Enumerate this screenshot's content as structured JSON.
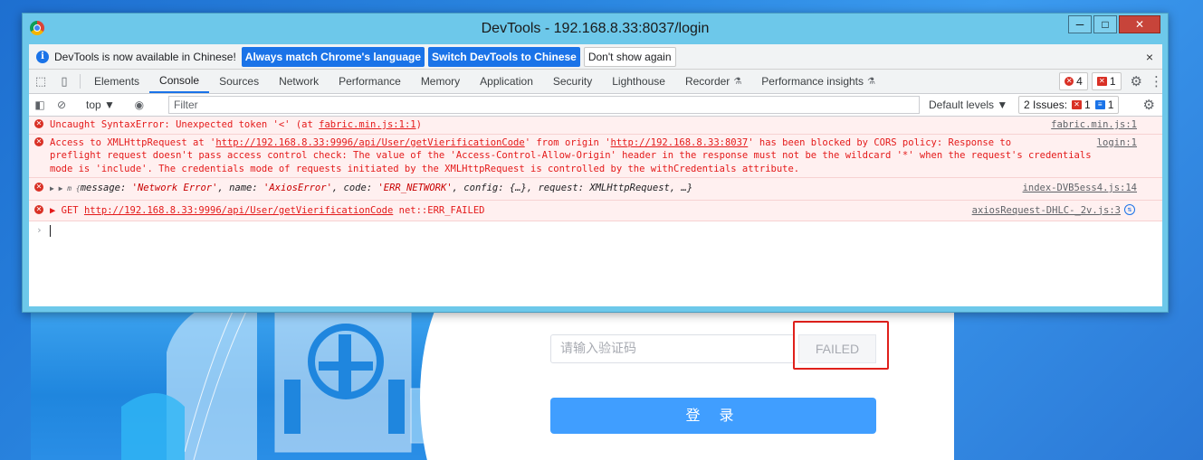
{
  "window": {
    "title": "DevTools - 192.168.8.33:8037/login",
    "minimize": "─",
    "maximize": "□",
    "close": "✕"
  },
  "infobar": {
    "message": "DevTools is now available in Chinese!",
    "match_language": "Always match Chrome's language",
    "switch_language": "Switch DevTools to Chinese",
    "dont_show": "Don't show again",
    "close": "×"
  },
  "tabs": [
    "Elements",
    "Console",
    "Sources",
    "Network",
    "Performance",
    "Memory",
    "Application",
    "Security",
    "Lighthouse",
    "Recorder",
    "Performance insights"
  ],
  "active_tab": "Console",
  "counts": {
    "errors": "4",
    "warnings": "1"
  },
  "filter": {
    "context": "top ▼",
    "placeholder": "Filter",
    "levels": "Default levels ▼",
    "issues_label": "2 Issues:",
    "issues_errors": "1",
    "issues_info": "1"
  },
  "messages": [
    {
      "text_a": "Uncaught SyntaxError: Unexpected token '<' (at ",
      "link": "fabric.min.js:1:1",
      "text_b": ")",
      "source": "fabric.min.js:1"
    },
    {
      "line1_a": "Access to XMLHttpRequest at '",
      "url1": "http://192.168.8.33:9996/api/User/getVierificationCode",
      "line1_b": "' from origin '",
      "url2": "http://192.168.8.33:8037",
      "line1_c": "' has been blocked by CORS policy: Response to",
      "line2": "preflight request doesn't pass access control check: The value of the 'Access-Control-Allow-Origin' header in the response must not be the wildcard '*' when the request's credentials",
      "line3": "mode is 'include'. The credentials mode of requests initiated by the XMLHttpRequest is controlled by the withCredentials attribute.",
      "source": "login:1"
    },
    {
      "prefix": "▶ ▶ m {",
      "k1": "message: ",
      "v1": "'Network Error'",
      "k2": ", name: ",
      "v2": "'AxiosError'",
      "k3": ", code: ",
      "v3": "'ERR_NETWORK'",
      "rest": ", config: {…}, request: XMLHttpRequest, …}",
      "source": "index-DVB5ess4.js:14"
    },
    {
      "method": "▶ GET ",
      "url": "http://192.168.8.33:9996/api/User/getVierificationCode",
      "status": " net::ERR_FAILED",
      "source": "axiosRequest-DHLC-_2v.js:3"
    }
  ],
  "prompt_symbol": "›",
  "login": {
    "captcha_placeholder": "请输入验证码",
    "captcha_image_text": "FAILED",
    "login_button": "登 录"
  }
}
